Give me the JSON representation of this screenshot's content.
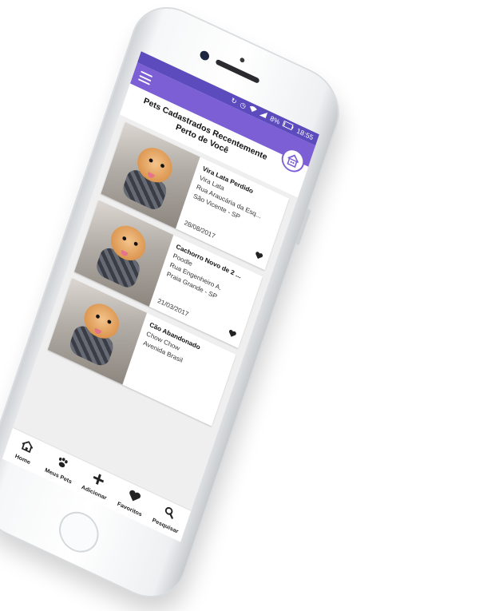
{
  "status_bar": {
    "battery_percent": "8%",
    "time": "18:55",
    "icons": [
      "sync-icon",
      "alarm-icon",
      "wifi-icon",
      "signal-icon",
      "battery-icon"
    ]
  },
  "toolbar": {
    "menu_icon": "hamburger-menu-icon",
    "color": "#7c5fd4",
    "status_color": "#5b4bbd"
  },
  "header": {
    "title": "Pets Cadastrados Recentemente Perto de Você",
    "icon": "pet-house-icon"
  },
  "pets": [
    {
      "title": "Vira Lata Perdido",
      "breed": "Vira Lata",
      "address": "Rua Araucária da Esq...",
      "city": "São Vicente - SP",
      "date": "28/08/2017"
    },
    {
      "title": "Cachorro Novo de 2 ...",
      "breed": "Poodle",
      "address": "Rua Engenheiro A.",
      "city": "Praia Grande - SP",
      "date": "21/03/2017"
    },
    {
      "title": "Cão Abandonado",
      "breed": "Chow Chow",
      "address": "Avenida Brasil",
      "city": "",
      "date": ""
    }
  ],
  "bottom_nav": [
    {
      "label": "Home",
      "icon": "home-icon"
    },
    {
      "label": "Meus Pets",
      "icon": "paw-icon"
    },
    {
      "label": "Adicionar",
      "icon": "plus-icon"
    },
    {
      "label": "Favoritos",
      "icon": "heart-icon"
    },
    {
      "label": "Pesquisar",
      "icon": "search-icon"
    }
  ]
}
